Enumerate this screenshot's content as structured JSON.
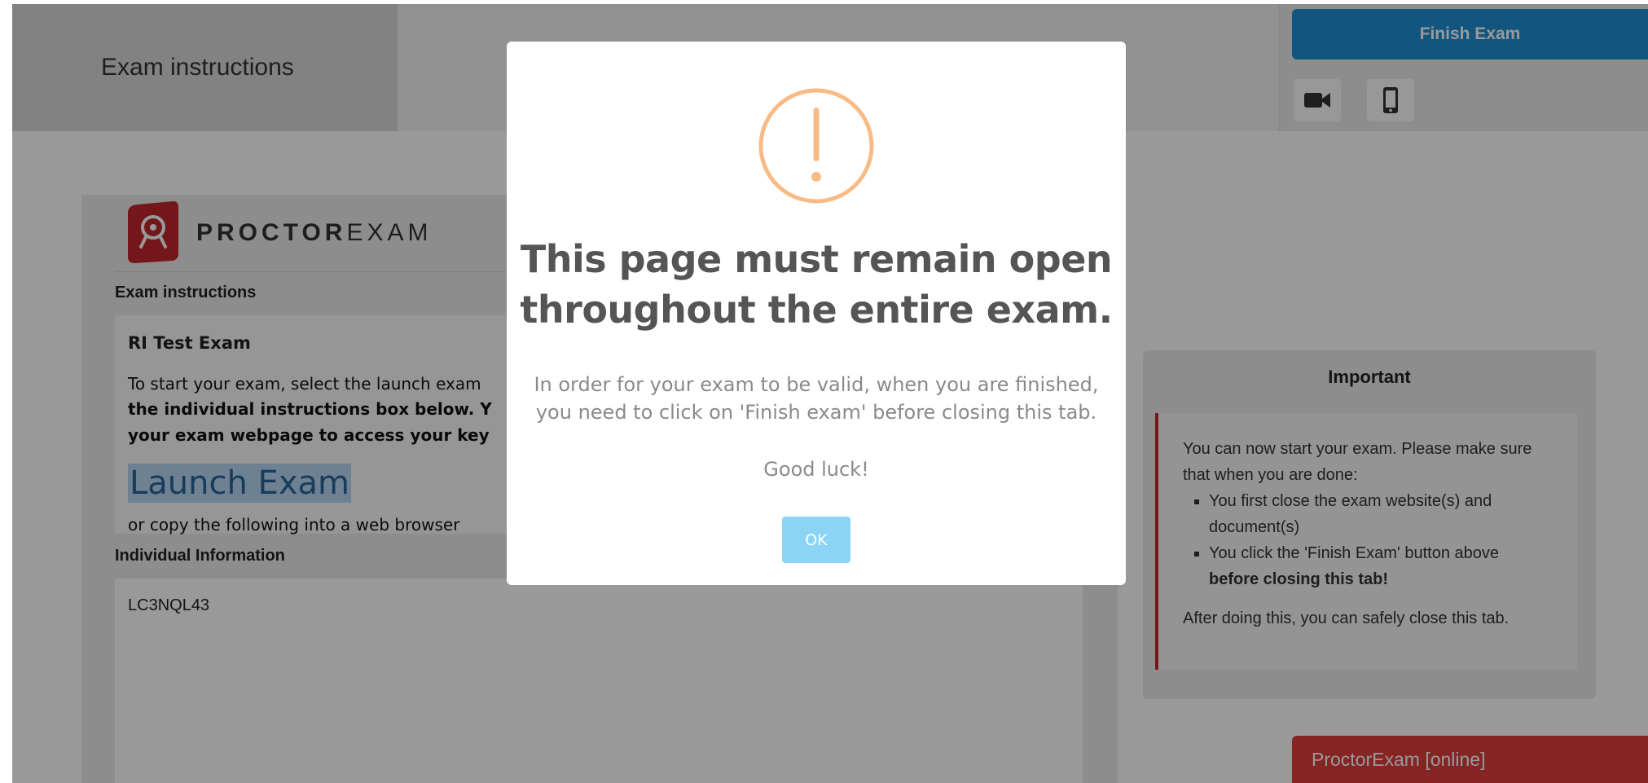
{
  "header": {
    "title": "Exam instructions",
    "finish_label": "Finish Exam"
  },
  "toolbar": {
    "icons": [
      "camera-icon",
      "phone-icon"
    ]
  },
  "brand": {
    "bold": "PROCTOR",
    "light": "EXAM"
  },
  "instructions": {
    "heading": "Exam instructions",
    "exam_name": "RI Test Exam",
    "line1": "To start your exam, select the launch exam",
    "line2": "the individual instructions box below. Y",
    "line3": "your exam webpage to access your key",
    "launch_label": "Launch Exam",
    "copy_text": "or copy the following into a web browser"
  },
  "individual": {
    "heading": "Individual Information",
    "code": "LC3NQL43"
  },
  "important": {
    "title": "Important",
    "intro": "You can now start your exam. Please make sure that when you are done:",
    "bullet1": "You first close the exam website(s) and document(s)",
    "bullet2_text": "You click the 'Finish Exam' button above ",
    "bullet2_bold": "before closing this tab!",
    "after": "After doing this, you can safely close this tab."
  },
  "status": {
    "label": "ProctorExam [online]"
  },
  "modal": {
    "title_line1": "This page must remain open",
    "title_line2": "throughout the entire exam.",
    "text": "In order for your exam to be valid, when you are finished, you need to click on 'Finish exam' before closing this tab.",
    "luck": "Good luck!",
    "ok_label": "OK"
  },
  "colors": {
    "finish_button": "#1f8fd6",
    "status_badge": "#e03c3c",
    "warning_icon": "#f8bb86",
    "ok_button": "#8cd4f5",
    "important_border": "#c62828"
  }
}
